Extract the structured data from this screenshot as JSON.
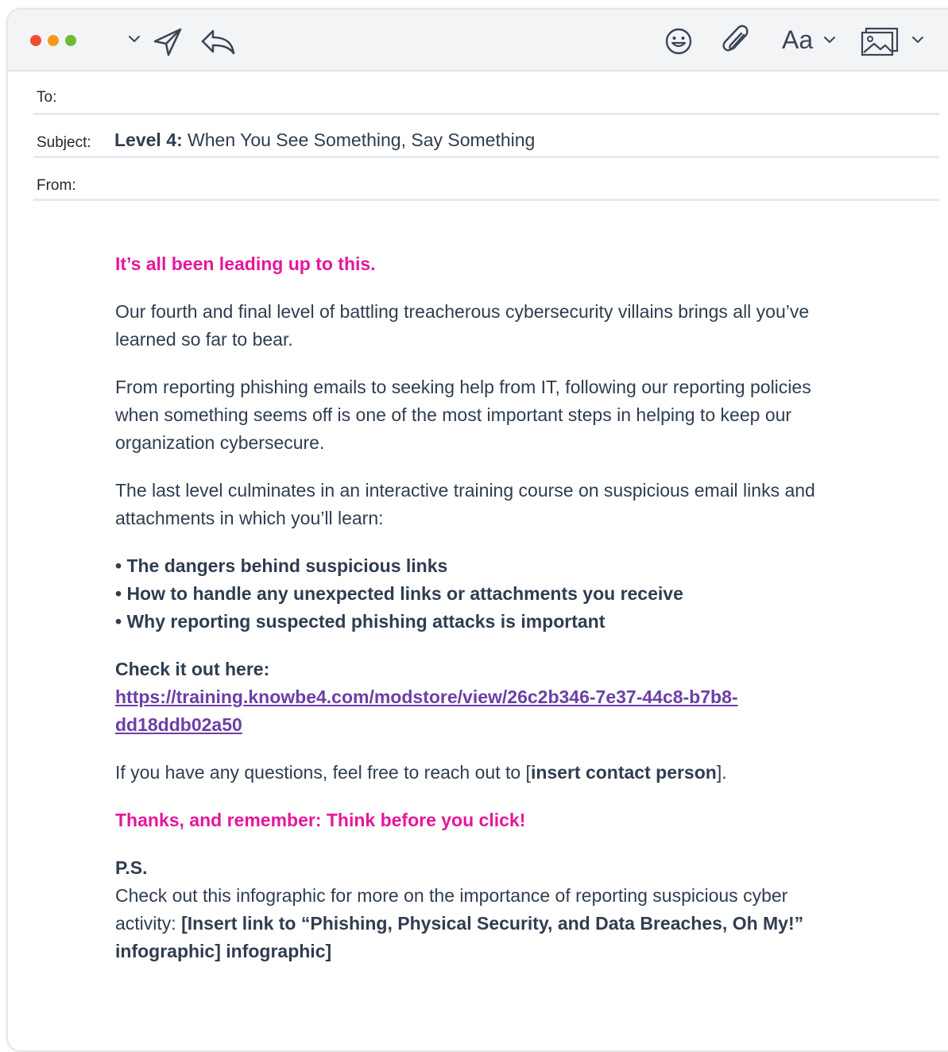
{
  "toolbar": {
    "lights": {
      "red": "#ef4d2c",
      "orange": "#f79a1c",
      "green": "#6bbd2f"
    },
    "icons": [
      "chevron-down-icon",
      "send-icon",
      "reply-icon",
      "emoji-icon",
      "paperclip-icon",
      "font-format-icon",
      "chevron-down-icon",
      "image-icon",
      "chevron-down-icon"
    ],
    "font_label": "Aa"
  },
  "fields": {
    "to_label": "To:",
    "subject_label": "Subject:",
    "from_label": "From:",
    "subject_bold": "Level 4:",
    "subject_text": " When You See Something, Say Something"
  },
  "body": {
    "headline": "It’s all been leading up to this.",
    "para1": "Our fourth and final level of battling treacherous cybersecurity villains brings all you’ve learned so far to bear.",
    "para2": "From reporting phishing emails to seeking help from IT, following our reporting policies when something seems off is one of the most important steps in helping to keep our organization cybersecure.",
    "para3": "The last level culminates in an interactive training course on suspicious email links and attachments in which you’ll learn:",
    "bullets": [
      "• The dangers behind suspicious links",
      "• How to handle any unexpected links or attachments you receive",
      "• Why reporting suspected phishing attacks is important"
    ],
    "check_label": "Check it out here:",
    "link": "https://training.knowbe4.com/modstore/view/26c2b346-7e37-44c8-b7b8-dd18ddb02a50",
    "questions_pre": "If you have any questions, feel free to reach out to [",
    "questions_contact": "insert contact person",
    "questions_post": "].",
    "thanks": "Thanks, and remember: Think before you click!",
    "ps_label": "P.S.",
    "ps_text": "Check out this infographic for more on the importance of reporting suspicious cyber activity: ",
    "ps_link_text": "[Insert link to “Phishing, Physical Security, and Data Breaches, Oh My!” infographic] infographic]"
  },
  "colors": {
    "pink": "#e6169d",
    "link": "#6b3fa7",
    "text": "#2f3d50"
  }
}
